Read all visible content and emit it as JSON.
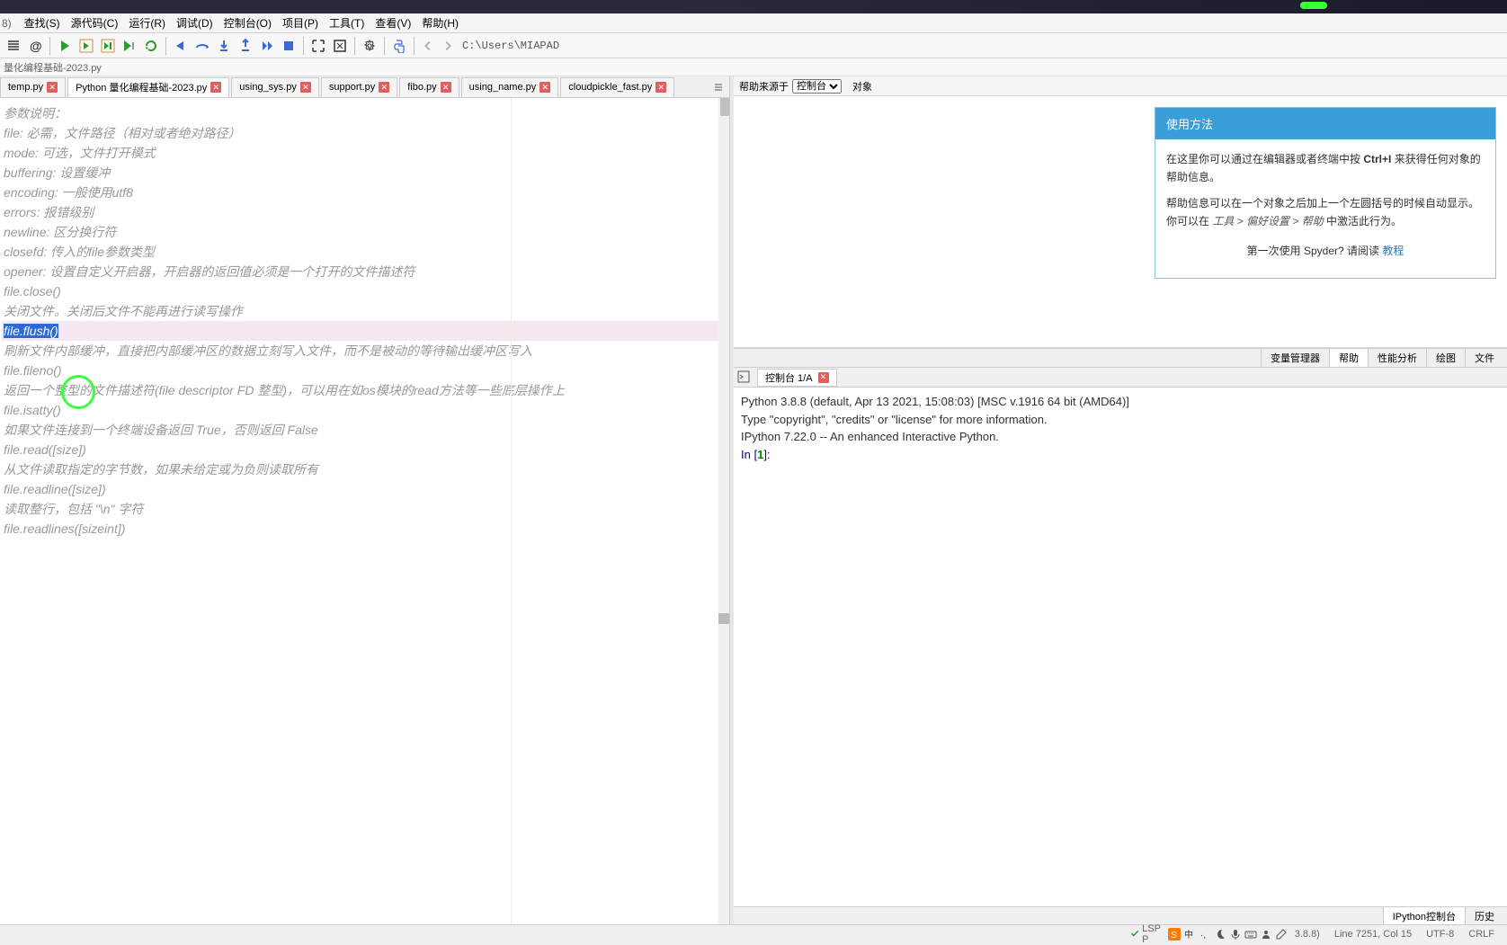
{
  "title_fragment": "8)",
  "menubar": {
    "items": [
      "查找(S)",
      "源代码(C)",
      "运行(R)",
      "调试(D)",
      "控制台(O)",
      "项目(P)",
      "工具(T)",
      "查看(V)",
      "帮助(H)"
    ]
  },
  "toolbar": {
    "path": "C:\\Users\\MIAPAD"
  },
  "breadcrumb": "  量化编程基础-2023.py",
  "tabs": [
    {
      "name": "temp.py",
      "active": false
    },
    {
      "name": "Python 量化编程基础-2023.py",
      "active": true
    },
    {
      "name": "using_sys.py",
      "active": false
    },
    {
      "name": "support.py",
      "active": false
    },
    {
      "name": "fibo.py",
      "active": false
    },
    {
      "name": "using_name.py",
      "active": false
    },
    {
      "name": "cloudpickle_fast.py",
      "active": false
    }
  ],
  "editor_lines": [
    "",
    "参数说明：",
    "",
    "file: 必需，文件路径（相对或者绝对路径）",
    "mode: 可选，文件打开模式",
    "buffering: 设置缓冲",
    "encoding: 一般使用utf8",
    "errors: 报错级别",
    "newline: 区分换行符",
    "closefd: 传入的file参数类型",
    "opener: 设置自定义开启器，开启器的返回值必须是一个打开的文件描述符",
    "",
    "",
    "file.close()",
    "",
    "关闭文件。关闭后文件不能再进行读写操作",
    "",
    "file.flush()",
    "",
    "刷新文件内部缓冲，直接把内部缓冲区的数据立刻写入文件，而不是被动的等待输出缓冲区写入",
    "",
    "",
    "file.fileno()",
    "",
    "返回一个整型的文件描述符(file descriptor FD 整型)，可以用在如os模块的read方法等一些底层操作上",
    "",
    "",
    "file.isatty()",
    "",
    "如果文件连接到一个终端设备返回 True，否则返回 False",
    "",
    "",
    "file.read([size])",
    "",
    "从文件读取指定的字节数，如果未给定或为负则读取所有",
    "",
    "",
    "file.readline([size])",
    "",
    "读取整行，包括 \"\\n\" 字符",
    "",
    "",
    "file.readlines([sizeint])",
    ""
  ],
  "help": {
    "source_label": "帮助来源于",
    "source_options": [
      "控制台"
    ],
    "object_label": "对象",
    "card_title": "使用方法",
    "body1_a": "在这里你可以通过在编辑器或者终端中按 ",
    "kbd": "Ctrl+I",
    "body1_b": " 来获得任何对象的帮助信息。",
    "body2_a": "帮助信息可以在一个对象之后加上一个左圆括号的时候自动显示。 你可以在 ",
    "body2_path": "工具 > 偏好设置 > 帮助",
    "body2_b": " 中激活此行为。",
    "footer_a": "第一次使用 Spyder? 请阅读 ",
    "footer_link": "教程"
  },
  "help_tabs": [
    "变量管理器",
    "帮助",
    "性能分析",
    "绘图",
    "文件"
  ],
  "console": {
    "tab_label": "控制台 1/A",
    "lines": [
      "Python 3.8.8 (default, Apr 13 2021, 15:08:03) [MSC v.1916 64 bit (AMD64)]",
      "Type \"copyright\", \"credits\" or \"license\" for more information.",
      "",
      "IPython 7.22.0 -- An enhanced Interactive Python.",
      ""
    ],
    "prompt_pre": "In [",
    "prompt_num": "1",
    "prompt_post": "]:"
  },
  "bottom_tabs": [
    "IPython控制台",
    "历史"
  ],
  "status": {
    "lsp": "LSP P",
    "version": "3.8.8)",
    "pos": "Line 7251, Col 15",
    "encoding": "UTF-8",
    "eol": "CRLF"
  }
}
